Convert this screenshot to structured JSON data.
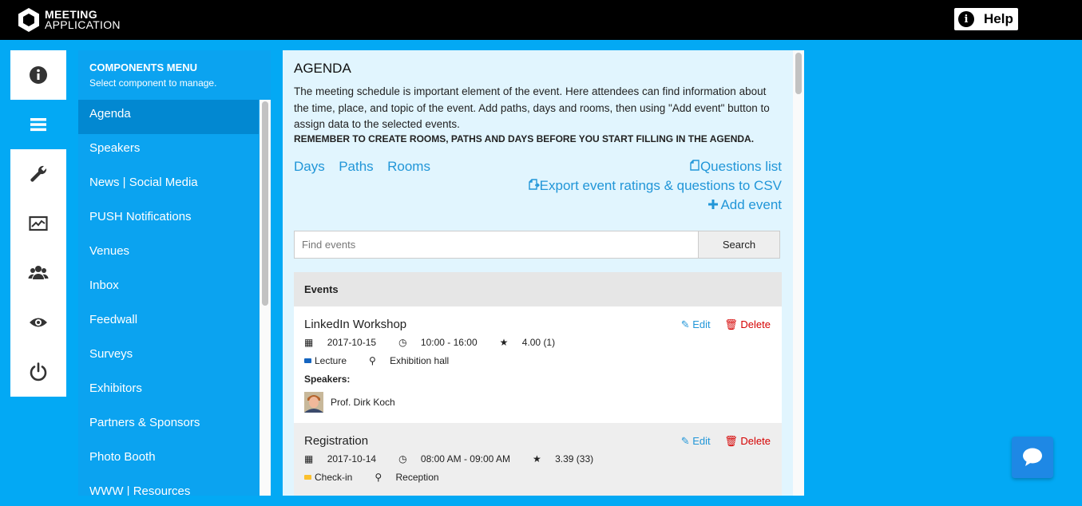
{
  "header": {
    "logo_line1": "MEETING",
    "logo_line2": "APPLICATION",
    "help_label": "Help"
  },
  "rail": {
    "items": [
      {
        "icon": "info-icon"
      },
      {
        "icon": "menu-icon",
        "active": true
      },
      {
        "icon": "wrench-icon"
      },
      {
        "icon": "chart-icon"
      },
      {
        "icon": "users-icon"
      },
      {
        "icon": "eye-icon"
      },
      {
        "icon": "power-icon"
      }
    ]
  },
  "components_menu": {
    "title": "COMPONENTS MENU",
    "subtitle": "Select component to manage.",
    "items": [
      {
        "label": "Agenda"
      },
      {
        "label": "Speakers"
      },
      {
        "label": "News | Social Media"
      },
      {
        "label": "PUSH Notifications"
      },
      {
        "label": "Venues"
      },
      {
        "label": "Inbox"
      },
      {
        "label": "Feedwall"
      },
      {
        "label": "Surveys"
      },
      {
        "label": "Exhibitors"
      },
      {
        "label": "Partners & Sponsors"
      },
      {
        "label": "Photo Booth"
      },
      {
        "label": "WWW | Resources"
      }
    ]
  },
  "agenda": {
    "title": "AGENDA",
    "description": "The meeting schedule is important element of the event. Here attendees can find information about the time, place, and topic of the event. Add paths, days and rooms, then using \"Add event\" button to assign data to the selected events.",
    "remember": "REMEMBER TO CREATE ROOMS, PATHS AND DAYS BEFORE YOU START FILLING IN THE AGENDA.",
    "links": {
      "days": "Days",
      "paths": "Paths",
      "rooms": "Rooms",
      "questions_list": "Questions list",
      "export": "Export event ratings & questions to CSV",
      "add_event": "Add event"
    },
    "search": {
      "placeholder": "Find events",
      "button": "Search"
    },
    "events_header": "Events",
    "edit_label": "Edit",
    "delete_label": "Delete",
    "speakers_label": "Speakers:",
    "events": [
      {
        "title": "LinkedIn Workshop",
        "date": "2017-10-15",
        "time": "10:00 - 16:00",
        "rating": "4.00 (1)",
        "path": "Lecture",
        "path_color": "#1565c0",
        "room": "Exhibition hall",
        "speaker": "Prof. Dirk Koch"
      },
      {
        "title": "Registration",
        "date": "2017-10-14",
        "time": "08:00 AM - 09:00 AM",
        "rating": "3.39 (33)",
        "path": "Check-in",
        "path_color": "#fbc02d",
        "room": "Reception"
      }
    ]
  }
}
